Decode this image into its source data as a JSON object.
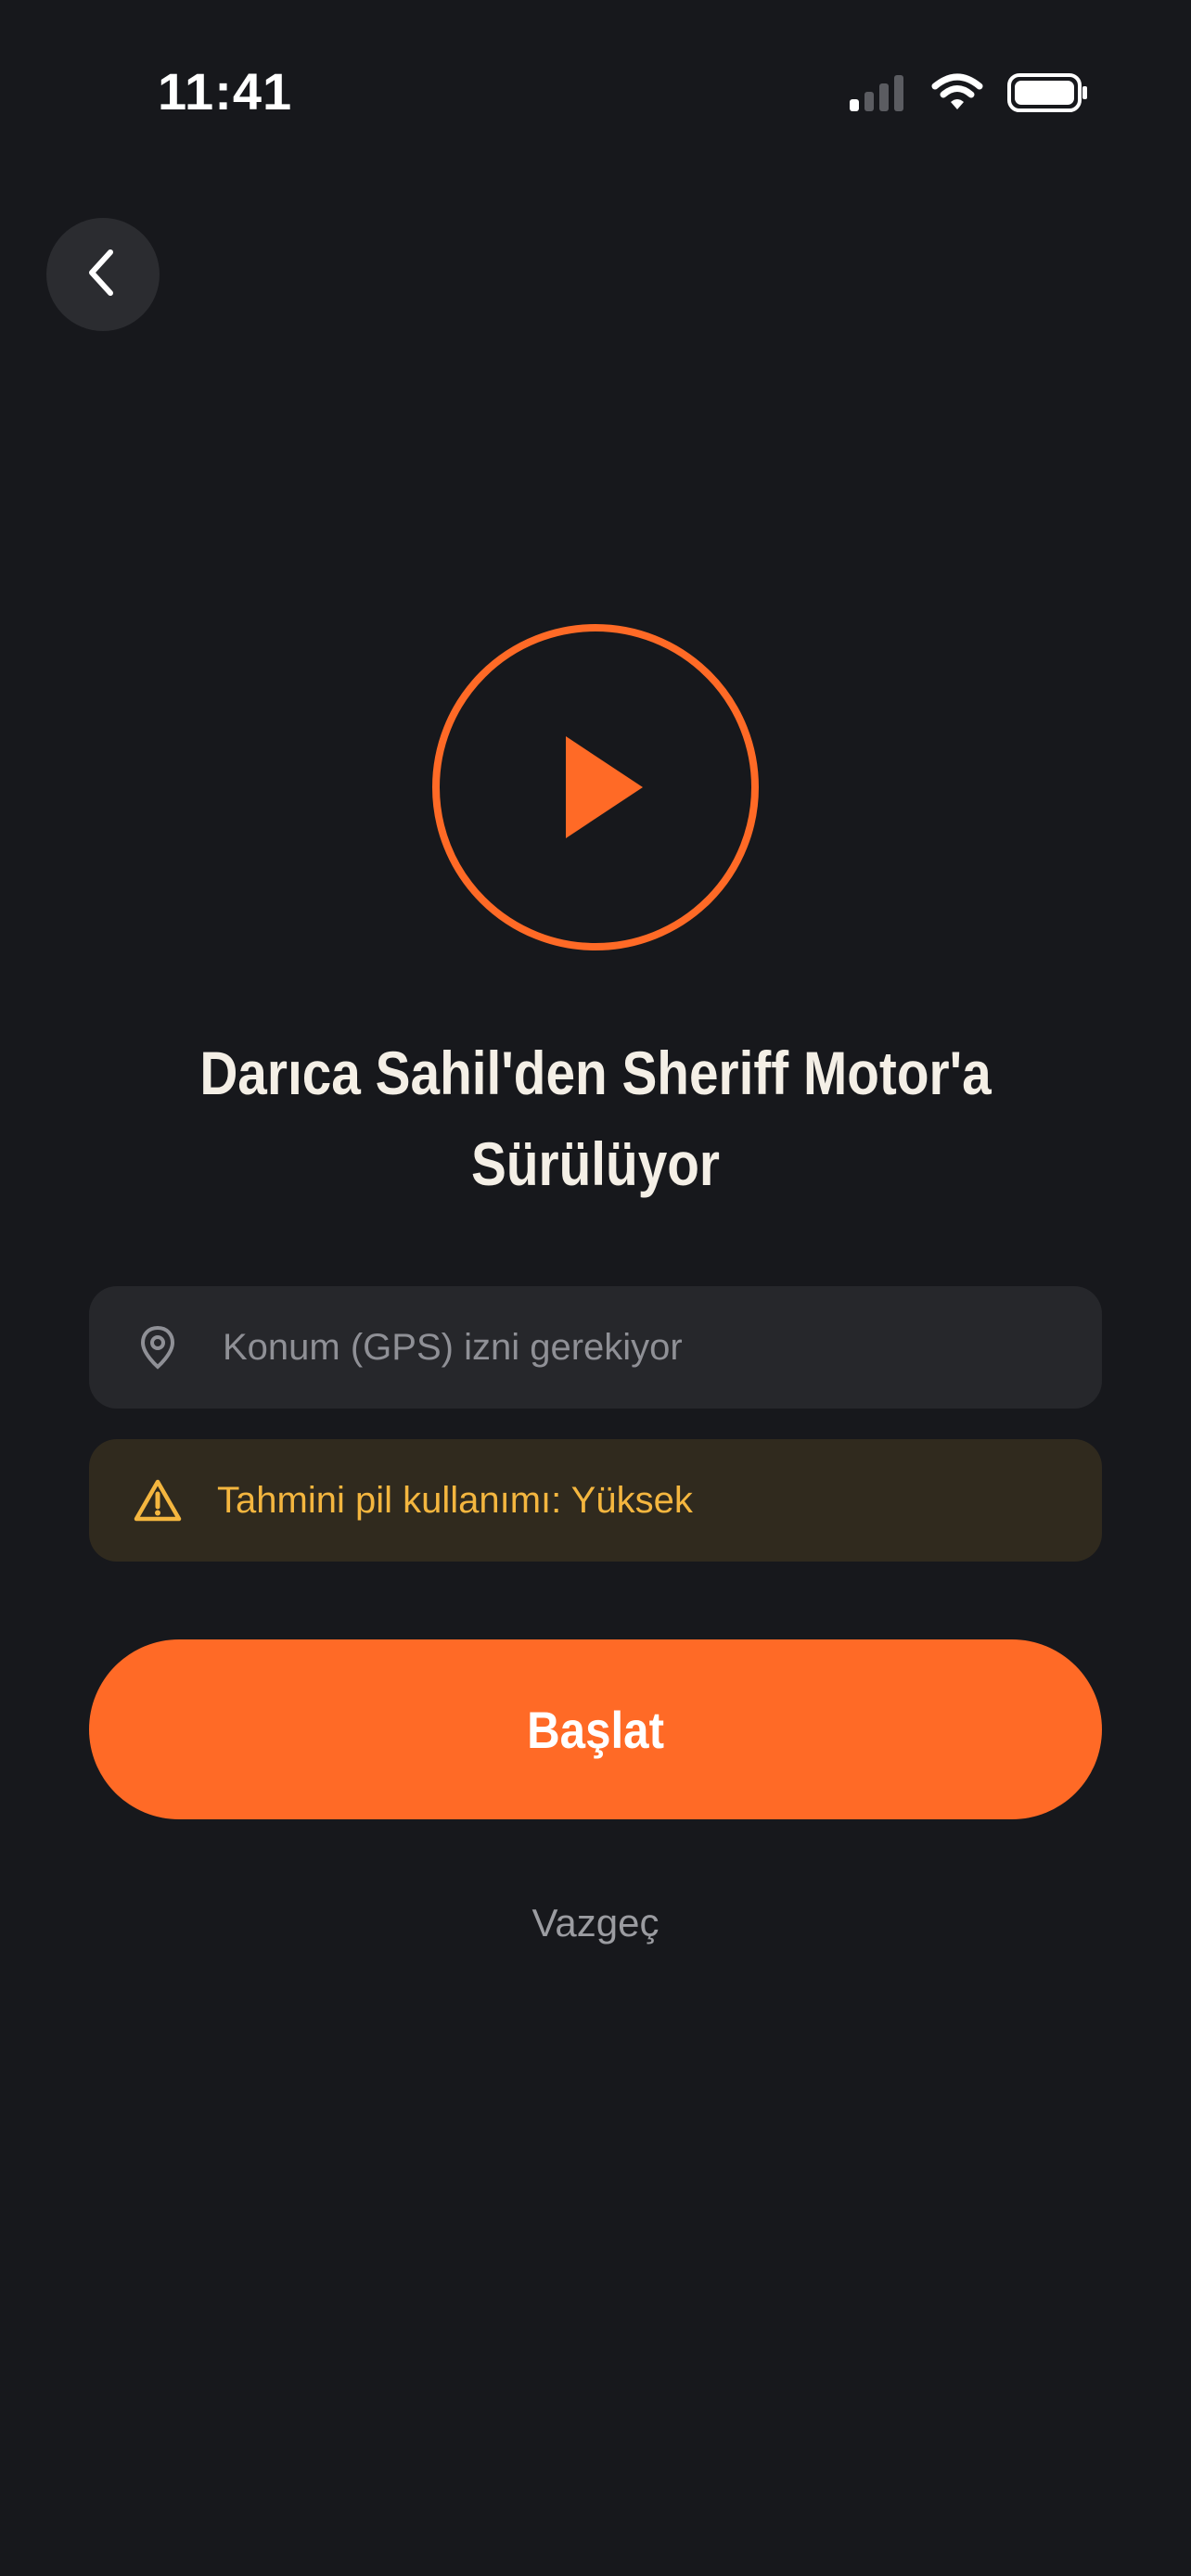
{
  "status_bar": {
    "time": "11:41",
    "icons": [
      "signal-icon",
      "wifi-icon",
      "battery-icon"
    ]
  },
  "navigation": {
    "back_icon": "chevron-left-icon"
  },
  "hero": {
    "icon": "play-circle-icon",
    "accent_color": "#ff6a26"
  },
  "title": {
    "line1": "Darıca Sahil'den Sheriff Motor'a",
    "line2": "Sürülüyor"
  },
  "gps_notice": {
    "icon": "location-pin-icon",
    "text": "Konum (GPS) izni gerekiyor"
  },
  "battery_notice": {
    "icon": "warning-icon",
    "text": "Tahmini pil kullanımı: Yüksek",
    "color": "#f4b63f"
  },
  "actions": {
    "start_label": "Başlat",
    "cancel_label": "Vazgeç"
  }
}
